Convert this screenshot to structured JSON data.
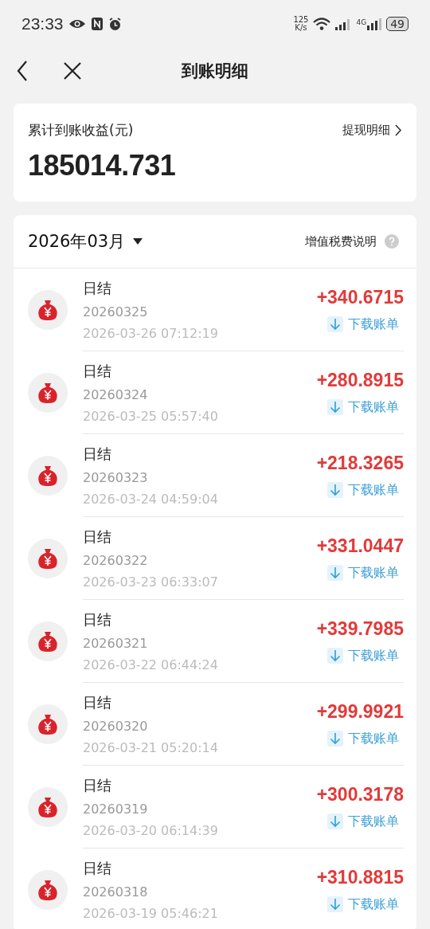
{
  "status_bar": {
    "time": "23:33",
    "speed_value": "125",
    "speed_unit": "K/s",
    "network": "4G",
    "battery": "49"
  },
  "header": {
    "title": "到账明细"
  },
  "summary": {
    "label": "累计到账收益(元)",
    "link": "提现明细",
    "total": "185014.731"
  },
  "list": {
    "month": "2026年03月",
    "tax_link": "增值税费说明",
    "rows": [
      {
        "title": "日结",
        "batch": "20260325",
        "time": "2026-03-26 07:12:19",
        "amount": "+340.6715",
        "action": "下载账单"
      },
      {
        "title": "日结",
        "batch": "20260324",
        "time": "2026-03-25 05:57:40",
        "amount": "+280.8915",
        "action": "下载账单"
      },
      {
        "title": "日结",
        "batch": "20260323",
        "time": "2026-03-24 04:59:04",
        "amount": "+218.3265",
        "action": "下载账单"
      },
      {
        "title": "日结",
        "batch": "20260322",
        "time": "2026-03-23 06:33:07",
        "amount": "+331.0447",
        "action": "下载账单"
      },
      {
        "title": "日结",
        "batch": "20260321",
        "time": "2026-03-22 06:44:24",
        "amount": "+339.7985",
        "action": "下载账单"
      },
      {
        "title": "日结",
        "batch": "20260320",
        "time": "2026-03-21 05:20:14",
        "amount": "+299.9921",
        "action": "下载账单"
      },
      {
        "title": "日结",
        "batch": "20260319",
        "time": "2026-03-20 06:14:39",
        "amount": "+300.3178",
        "action": "下载账单"
      },
      {
        "title": "日结",
        "batch": "20260318",
        "time": "2026-03-19 05:46:21",
        "amount": "+310.8815",
        "action": "下载账单"
      }
    ]
  }
}
